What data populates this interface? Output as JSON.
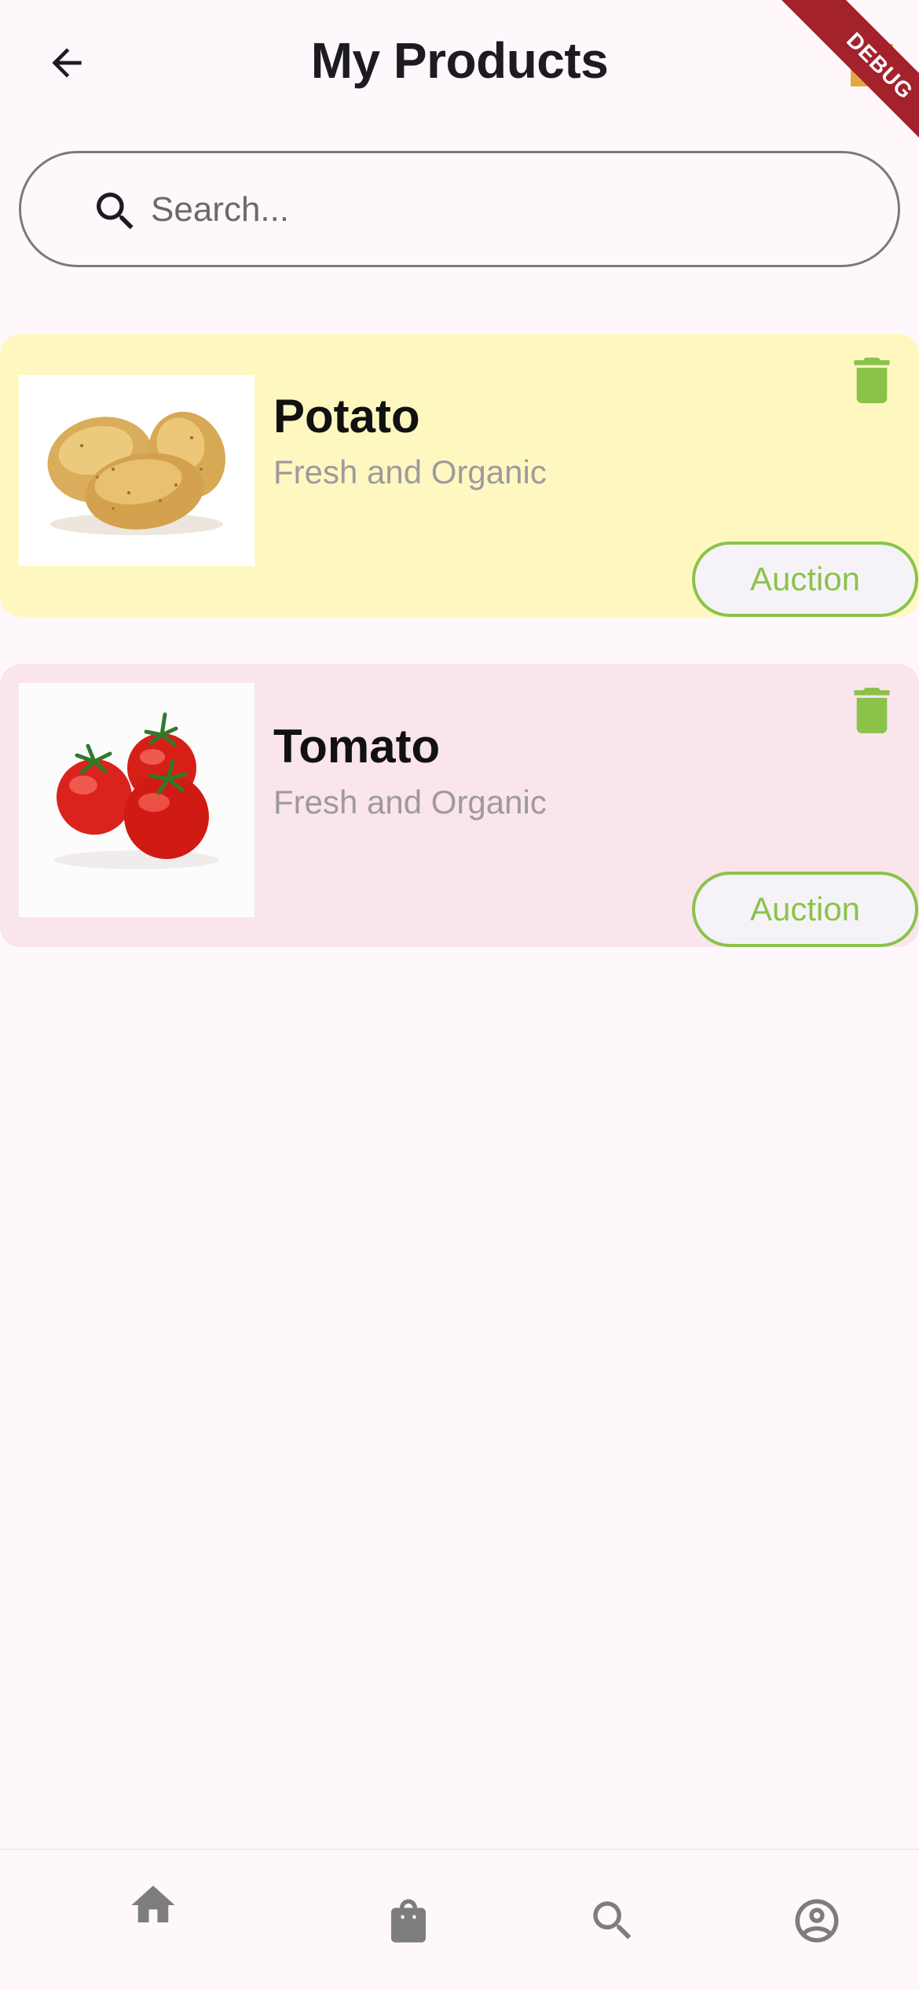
{
  "appbar": {
    "title": "My Products",
    "back_icon": "arrow-back-icon",
    "debug_banner": "DEBUG"
  },
  "search": {
    "placeholder": "Search...",
    "value": "",
    "icon": "search-icon"
  },
  "products": [
    {
      "name": "Potato",
      "description": "Fresh and Organic",
      "action_label": "Auction",
      "image": "potato-image",
      "card_color": "#fef8c0"
    },
    {
      "name": "Tomato",
      "description": "Fresh and Organic",
      "action_label": "Auction",
      "image": "tomato-image",
      "card_color": "#fae5ec"
    }
  ],
  "bottom_nav": {
    "items": [
      {
        "icon": "home-icon",
        "active": true
      },
      {
        "icon": "shopping-bag-icon",
        "active": false
      },
      {
        "icon": "search-icon",
        "active": false
      },
      {
        "icon": "account-circle-icon",
        "active": false
      }
    ]
  },
  "colors": {
    "background": "#fef8fc",
    "accent_green": "#8bc34a",
    "debug_red": "#a3222c",
    "nav_icon_gray": "#7d7d7d"
  }
}
